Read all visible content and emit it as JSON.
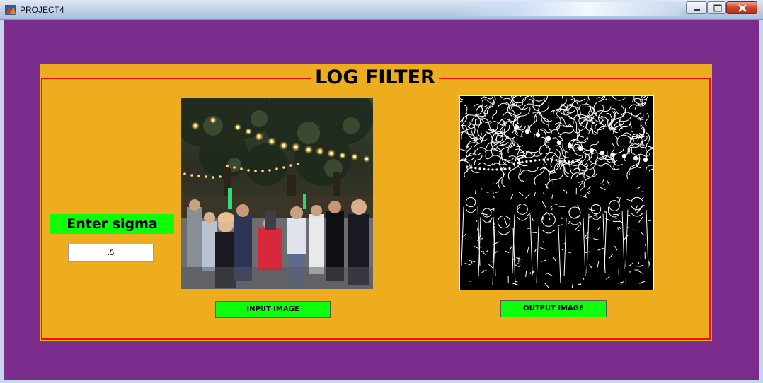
{
  "window": {
    "title": "PROJECT4",
    "controls": [
      "minimize",
      "maximize",
      "close"
    ]
  },
  "panel": {
    "title": "LOG FILTER",
    "sigma_label": "Enter sigma",
    "sigma_value": ".5",
    "input_image_alt": "input-image",
    "output_image_alt": "output-image",
    "input_button": "INPUT IMAGE",
    "output_button": "OUTPUT IMAGE"
  },
  "colors": {
    "background": "#7b2d8e",
    "panel": "#edad1f",
    "panel_border": "#ee1010",
    "button": "#0dff0d"
  }
}
